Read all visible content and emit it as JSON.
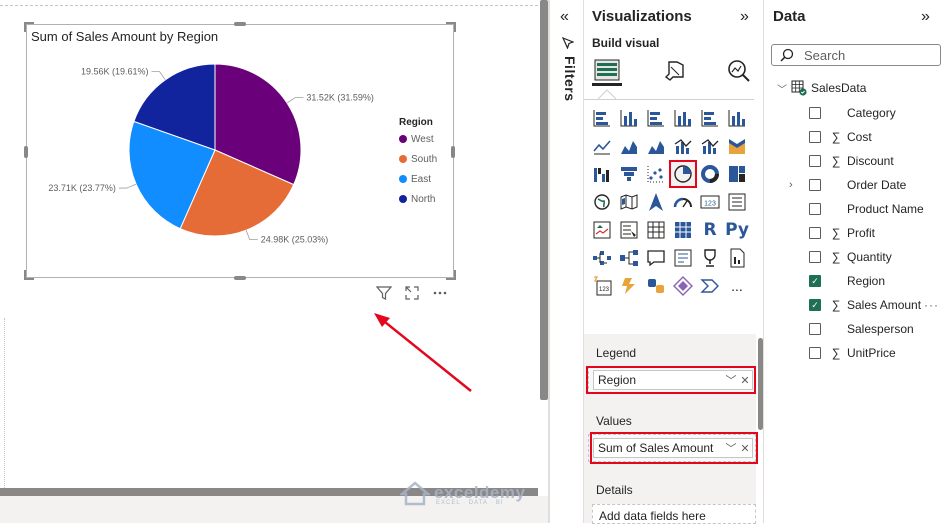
{
  "canvas": {
    "visual_actions": [
      "filter-icon",
      "focus-mode-icon",
      "more-options-icon"
    ]
  },
  "chart_data": {
    "type": "pie",
    "title": "Sum of Sales Amount by Region",
    "legend_title": "Region",
    "legend_position": "right",
    "slices": [
      {
        "name": "West",
        "value": 31520,
        "percent": 31.59,
        "label": "31.52K (31.59%)",
        "color": "#6b007b"
      },
      {
        "name": "South",
        "value": 24980,
        "percent": 25.03,
        "label": "24.98K (25.03%)",
        "color": "#e66c37"
      },
      {
        "name": "East",
        "value": 23710,
        "percent": 23.77,
        "label": "23.71K (23.77%)",
        "color": "#118dff"
      },
      {
        "name": "North",
        "value": 19560,
        "percent": 19.61,
        "label": "19.56K (19.61%)",
        "color": "#12239e"
      }
    ]
  },
  "filters": {
    "label": "Filters"
  },
  "visualizations": {
    "title": "Visualizations",
    "build_label": "Build visual",
    "selected_visual": "pie-chart",
    "more_visuals": "...",
    "wells": {
      "legend": {
        "label": "Legend",
        "field": "Region"
      },
      "values": {
        "label": "Values",
        "field": "Sum of Sales Amount"
      },
      "details": {
        "label": "Details",
        "placeholder": "Add data fields here"
      }
    },
    "icon_text": {
      "r_visual": "R",
      "python_visual": "Py"
    }
  },
  "data_pane": {
    "title": "Data",
    "search_placeholder": "Search",
    "table": "SalesData",
    "fields": [
      {
        "name": "Category",
        "sigma": false,
        "checked": false,
        "expandable": false
      },
      {
        "name": "Cost",
        "sigma": true,
        "checked": false,
        "expandable": false
      },
      {
        "name": "Discount",
        "sigma": true,
        "checked": false,
        "expandable": false
      },
      {
        "name": "Order Date",
        "sigma": false,
        "checked": false,
        "expandable": true
      },
      {
        "name": "Product Name",
        "sigma": false,
        "checked": false,
        "expandable": false
      },
      {
        "name": "Profit",
        "sigma": true,
        "checked": false,
        "expandable": false
      },
      {
        "name": "Quantity",
        "sigma": true,
        "checked": false,
        "expandable": false
      },
      {
        "name": "Region",
        "sigma": false,
        "checked": true,
        "expandable": false
      },
      {
        "name": "Sales Amount",
        "sigma": true,
        "checked": true,
        "expandable": false
      },
      {
        "name": "Salesperson",
        "sigma": false,
        "checked": false,
        "expandable": false
      },
      {
        "name": "UnitPrice",
        "sigma": true,
        "checked": false,
        "expandable": false
      }
    ],
    "sigma_symbol": "∑",
    "check_symbol": "✓",
    "more_options": "···"
  },
  "watermark": {
    "name": "exceldemy",
    "tagline": "EXCEL · DATA · BI"
  }
}
